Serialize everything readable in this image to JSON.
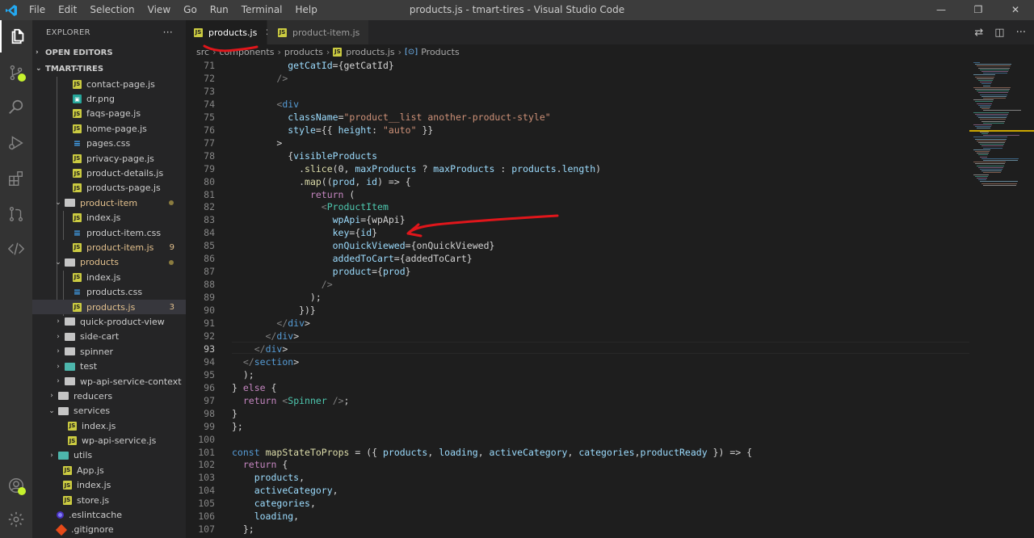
{
  "titlebar": {
    "menu": [
      "File",
      "Edit",
      "Selection",
      "View",
      "Go",
      "Run",
      "Terminal",
      "Help"
    ],
    "title": "products.js - tmart-tires - Visual Studio Code",
    "controls": [
      "—",
      "❐",
      "✕"
    ]
  },
  "sidebar": {
    "header": "EXPLORER",
    "more": "···",
    "open_editors": "OPEN EDITORS",
    "project": "TMART-TIRES",
    "items": [
      {
        "label": "contact-page.js"
      },
      {
        "label": "dr.png"
      },
      {
        "label": "faqs-page.js"
      },
      {
        "label": "home-page.js"
      },
      {
        "label": "pages.css"
      },
      {
        "label": "privacy-page.js"
      },
      {
        "label": "product-details.js"
      },
      {
        "label": "products-page.js"
      },
      {
        "label": "product-item"
      },
      {
        "label": "index.js"
      },
      {
        "label": "product-item.css"
      },
      {
        "label": "product-item.js",
        "badge": "9"
      },
      {
        "label": "products"
      },
      {
        "label": "index.js"
      },
      {
        "label": "products.css"
      },
      {
        "label": "products.js",
        "badge": "3"
      },
      {
        "label": "quick-product-view"
      },
      {
        "label": "side-cart"
      },
      {
        "label": "spinner"
      },
      {
        "label": "test"
      },
      {
        "label": "wp-api-service-context"
      },
      {
        "label": "reducers"
      },
      {
        "label": "services"
      },
      {
        "label": "index.js"
      },
      {
        "label": "wp-api-service.js"
      },
      {
        "label": "utils"
      },
      {
        "label": "App.js"
      },
      {
        "label": "index.js"
      },
      {
        "label": "store.js"
      },
      {
        "label": ".eslintcache"
      },
      {
        "label": ".gitignore"
      }
    ]
  },
  "tabs": [
    {
      "label": "products.js",
      "close": "✕"
    },
    {
      "label": "product-item.js"
    }
  ],
  "breadcrumb": [
    "src",
    "components",
    "products",
    "products.js",
    "Products"
  ],
  "editor": {
    "line_numbers": [
      "71",
      "72",
      "73",
      "74",
      "75",
      "76",
      "77",
      "78",
      "79",
      "80",
      "81",
      "82",
      "83",
      "84",
      "85",
      "86",
      "87",
      "88",
      "89",
      "90",
      "91",
      "92",
      "93",
      "94",
      "95",
      "96",
      "97",
      "98",
      "99",
      "100",
      "101",
      "102",
      "103",
      "104",
      "105",
      "106",
      "107"
    ],
    "lines": [
      "          getCatId={getCatId}",
      "        />",
      "",
      "        <div",
      "          className=\"product__list another-product-style\"",
      "          style={{ height: \"auto\" }}",
      "        >",
      "          {visibleProducts",
      "            .slice(0, maxProducts ? maxProducts : products.length)",
      "            .map((prod, id) => {",
      "              return (",
      "                <ProductItem",
      "                  wpApi={wpApi}",
      "                  key={id}",
      "                  onQuickViewed={onQuickViewed}",
      "                  addedToCart={addedToCart}",
      "                  product={prod}",
      "                />",
      "              );",
      "            })}",
      "        </div>",
      "      </div>",
      "    </div>",
      "  </section>",
      "  );",
      "} else {",
      "  return <Spinner />;",
      "}",
      "};",
      "",
      "const mapStateToProps = ({ products, loading, activeCategory, categories,productReady }) => {",
      "  return {",
      "    products,",
      "    activeCategory,",
      "    categories,",
      "    loading,",
      "  };"
    ]
  },
  "colors": {
    "accent": "#007acc",
    "annotation": "#e0161b",
    "activity_badge": "#c6f22d"
  }
}
